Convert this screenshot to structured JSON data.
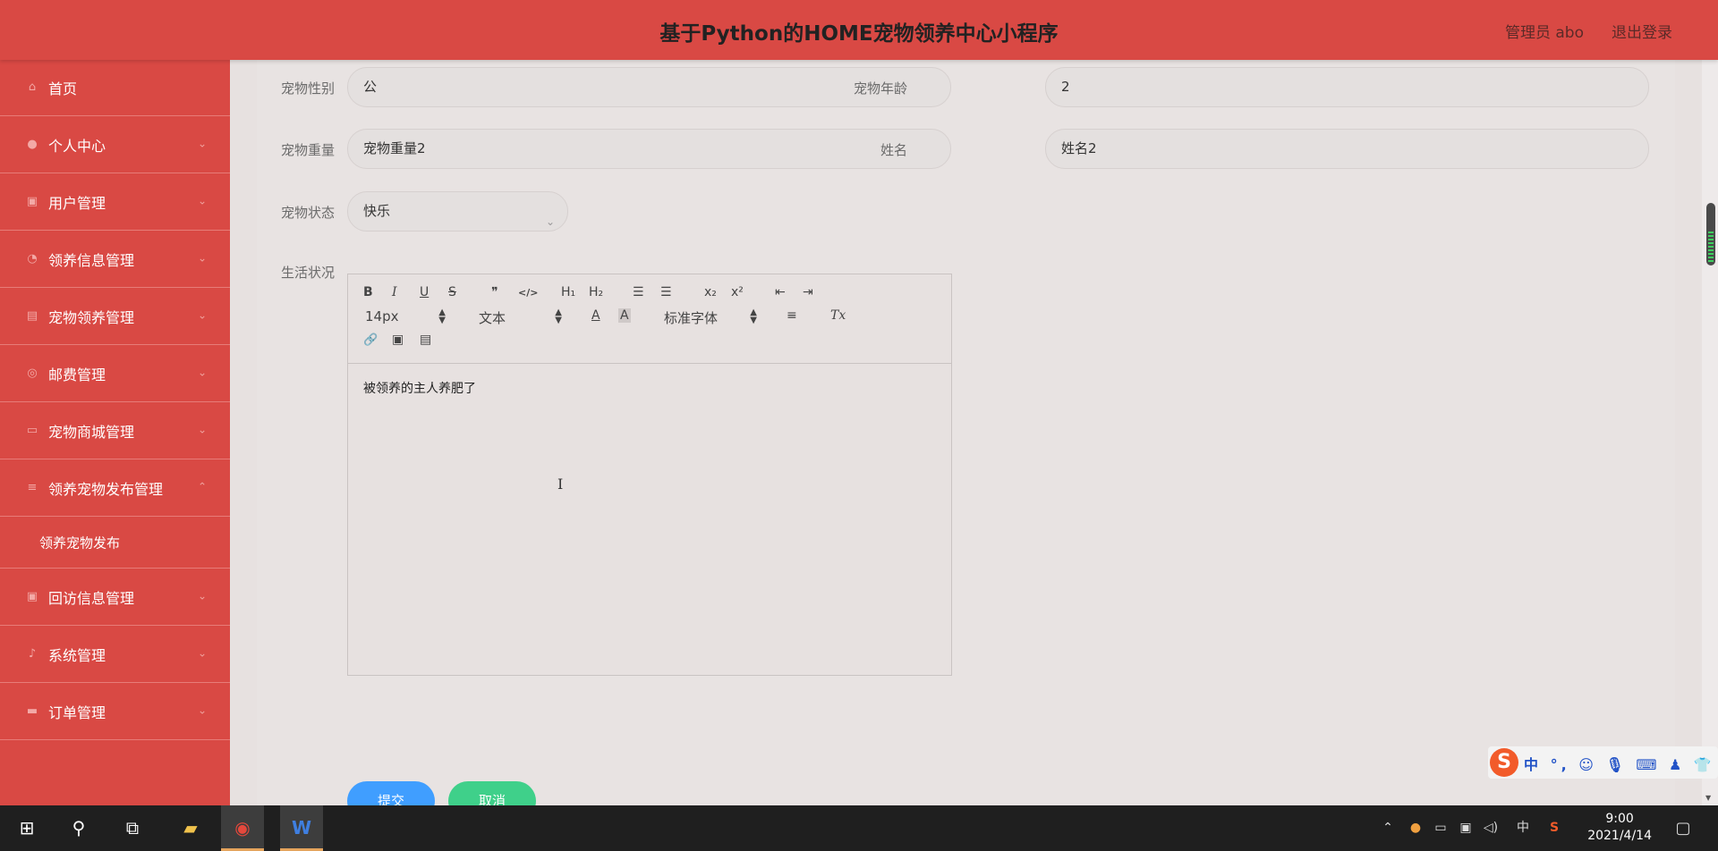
{
  "header": {
    "title": "基于Python的HOME宠物领养中心小程序",
    "admin": "管理员 abo",
    "logout": "退出登录"
  },
  "sidebar": {
    "items": [
      {
        "label": "首页",
        "icon": "home-icon"
      },
      {
        "label": "个人中心",
        "icon": "user-icon"
      },
      {
        "label": "用户管理",
        "icon": "clipboard-icon"
      },
      {
        "label": "领养信息管理",
        "icon": "dashboard-icon"
      },
      {
        "label": "宠物领养管理",
        "icon": "table-icon"
      },
      {
        "label": "邮费管理",
        "icon": "compass-icon"
      },
      {
        "label": "宠物商城管理",
        "icon": "chat-icon"
      },
      {
        "label": "领养宠物发布管理",
        "icon": "menu-icon"
      },
      {
        "label": "回访信息管理",
        "icon": "clipboard-icon"
      },
      {
        "label": "系统管理",
        "icon": "mic-icon"
      },
      {
        "label": "订单管理",
        "icon": "ticket-icon"
      }
    ],
    "sub_item": "领养宠物发布"
  },
  "form": {
    "gender_label": "宠物性别",
    "gender_value": "公",
    "age_label": "宠物年龄",
    "age_value": "2",
    "weight_label": "宠物重量",
    "weight_value": "宠物重量2",
    "name_label": "姓名",
    "name_value": "姓名2",
    "status_label": "宠物状态",
    "status_value": "快乐",
    "life_label": "生活状况",
    "life_content": "被领养的主人养肥了",
    "submit": "提交",
    "cancel": "取消"
  },
  "editor_toolbar": {
    "bold": "B",
    "italic": "I",
    "underline": "U",
    "strike": "S",
    "quote": "❞",
    "code": "</>",
    "h1": "H₁",
    "h2": "H₂",
    "ol": "☰",
    "ul": "☰",
    "sub": "x₂",
    "sup": "x²",
    "indent_out": "⇤",
    "indent_in": "⇥",
    "size": "14px",
    "block": "文本",
    "font": "标准字体",
    "color": "A",
    "bg": "A",
    "align": "≡",
    "clean": "Tx",
    "link": "🔗",
    "image": "▣",
    "video": "▤"
  },
  "ime": {
    "text": "中 °, ☺ 🎙 ⌨ ♟ 👕 ▦"
  },
  "taskbar": {
    "clock_time": "9:00",
    "clock_date": "2021/4/14",
    "lang": "中"
  },
  "colors": {
    "primary": "#d94944",
    "submit": "#409eff",
    "cancel": "#67c23a"
  }
}
